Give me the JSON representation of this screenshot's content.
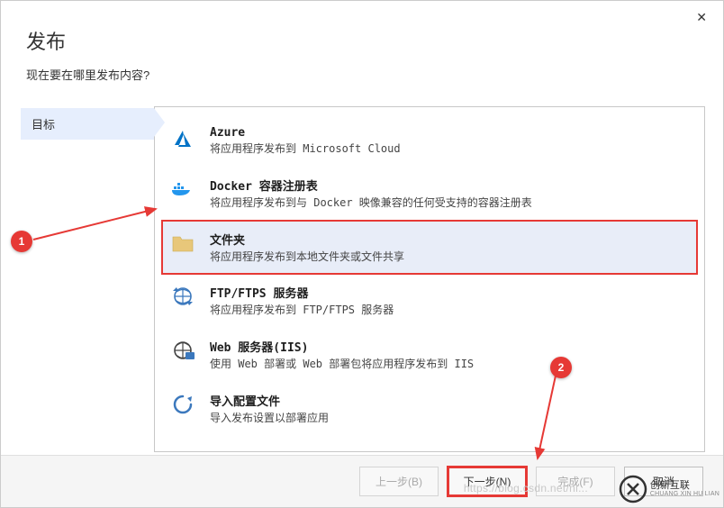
{
  "window": {
    "close_label": "✕"
  },
  "header": {
    "title": "发布",
    "subtitle": "现在要在哪里发布内容?"
  },
  "sidebar": {
    "tab_label": "目标"
  },
  "options": [
    {
      "title": "Azure",
      "desc": "将应用程序发布到 Microsoft Cloud",
      "icon": "azure"
    },
    {
      "title": "Docker 容器注册表",
      "desc": "将应用程序发布到与 Docker 映像兼容的任何受支持的容器注册表",
      "icon": "docker"
    },
    {
      "title": "文件夹",
      "desc": "将应用程序发布到本地文件夹或文件共享",
      "icon": "folder",
      "selected": true
    },
    {
      "title": "FTP/FTPS 服务器",
      "desc": "将应用程序发布到 FTP/FTPS 服务器",
      "icon": "ftp"
    },
    {
      "title": "Web 服务器(IIS)",
      "desc": "使用 Web 部署或 Web 部署包将应用程序发布到 IIS",
      "icon": "iis"
    },
    {
      "title": "导入配置文件",
      "desc": "导入发布设置以部署应用",
      "icon": "import"
    }
  ],
  "callouts": {
    "one": "1",
    "two": "2"
  },
  "footer": {
    "back": "上一步(B)",
    "next": "下一步(N)",
    "finish": "完成(F)",
    "cancel": "取消"
  },
  "watermark": {
    "url": "https://blog.csdn.net/nl...",
    "brand": "创新互联",
    "brand_sub": "CHUANG XIN HU LIAN"
  },
  "colors": {
    "highlight_bg": "#e8edf8",
    "callout_red": "#e63935"
  }
}
